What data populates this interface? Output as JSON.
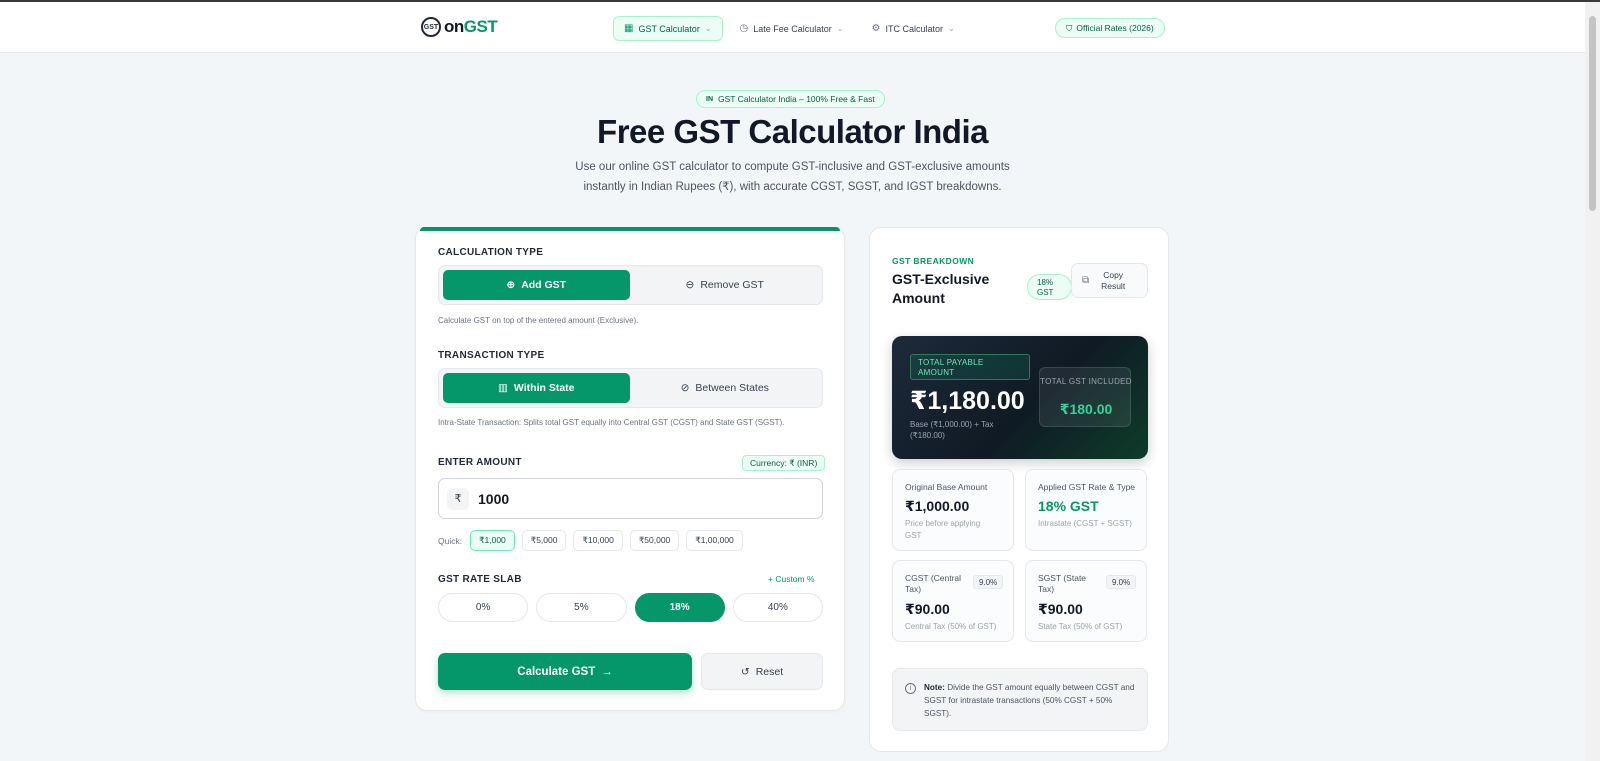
{
  "header": {
    "logo_badge": "GST",
    "logo_on": "on",
    "logo_gst": "GST",
    "nav": [
      {
        "label": "GST Calculator",
        "icon": "calculator-icon"
      },
      {
        "label": "Late Fee Calculator",
        "icon": "clock-icon"
      },
      {
        "label": "ITC Calculator",
        "icon": "gear-icon"
      }
    ],
    "rates_pill": "Official Rates (2026)"
  },
  "hero": {
    "pill": "GST Calculator India – 100% Free & Fast",
    "title": "Free GST Calculator India",
    "subtitle": "Use our online GST calculator to compute GST-inclusive and GST-exclusive amounts instantly in Indian Rupees (₹), with accurate CGST, SGST, and IGST breakdowns."
  },
  "form": {
    "calc_type_label": "CALCULATION TYPE",
    "add_gst": "Add GST",
    "remove_gst": "Remove GST",
    "calc_type_hint": "Calculate GST on top of the entered amount (Exclusive).",
    "txn_type_label": "TRANSACTION TYPE",
    "within_state": "Within State",
    "between_states": "Between States",
    "txn_type_hint": "Intra-State Transaction: Splits total GST equally into Central GST (CGST) and State GST (SGST).",
    "amount_label": "ENTER AMOUNT",
    "currency_pill": "Currency: ₹ (INR)",
    "rupee_symbol": "₹",
    "amount_value": "1000",
    "quick_label": "Quick:",
    "quick": [
      "₹1,000",
      "₹5,000",
      "₹10,000",
      "₹50,000",
      "₹1,00,000"
    ],
    "rate_label": "GST RATE SLAB",
    "custom_link": "+ Custom %",
    "rates": [
      "0%",
      "5%",
      "18%",
      "40%"
    ],
    "calculate": "Calculate GST",
    "reset": "Reset"
  },
  "breakdown": {
    "label": "GST BREAKDOWN",
    "title": "GST-Exclusive Amount",
    "rate_badge_1": "18%",
    "rate_badge_2": "GST",
    "copy_1": "Copy",
    "copy_2": "Result",
    "total_label": "TOTAL PAYABLE AMOUNT",
    "total_value": "₹1,180.00",
    "total_note": "Base (₹1,000.00) + Tax (₹180.00)",
    "gst_included_label": "TOTAL GST INCLUDED",
    "gst_included_value": "₹180.00",
    "base_label": "Original Base Amount",
    "base_value": "₹1,000.00",
    "base_note": "Price before applying GST",
    "applied_label": "Applied GST Rate & Type",
    "applied_value": "18% GST",
    "applied_note": "Intrastate (CGST + SGST)",
    "cgst_label": "CGST (Central Tax)",
    "cgst_rate": "9.0%",
    "cgst_value": "₹90.00",
    "cgst_note": "Central Tax (50% of GST)",
    "sgst_label": "SGST (State Tax)",
    "sgst_rate": "9.0%",
    "sgst_value": "₹90.00",
    "sgst_note": "State Tax (50% of GST)",
    "note_bold": "Note:",
    "note_text": " Divide the GST amount equally between CGST and SGST for intrastate transactions (50% CGST + 50% SGST)."
  }
}
